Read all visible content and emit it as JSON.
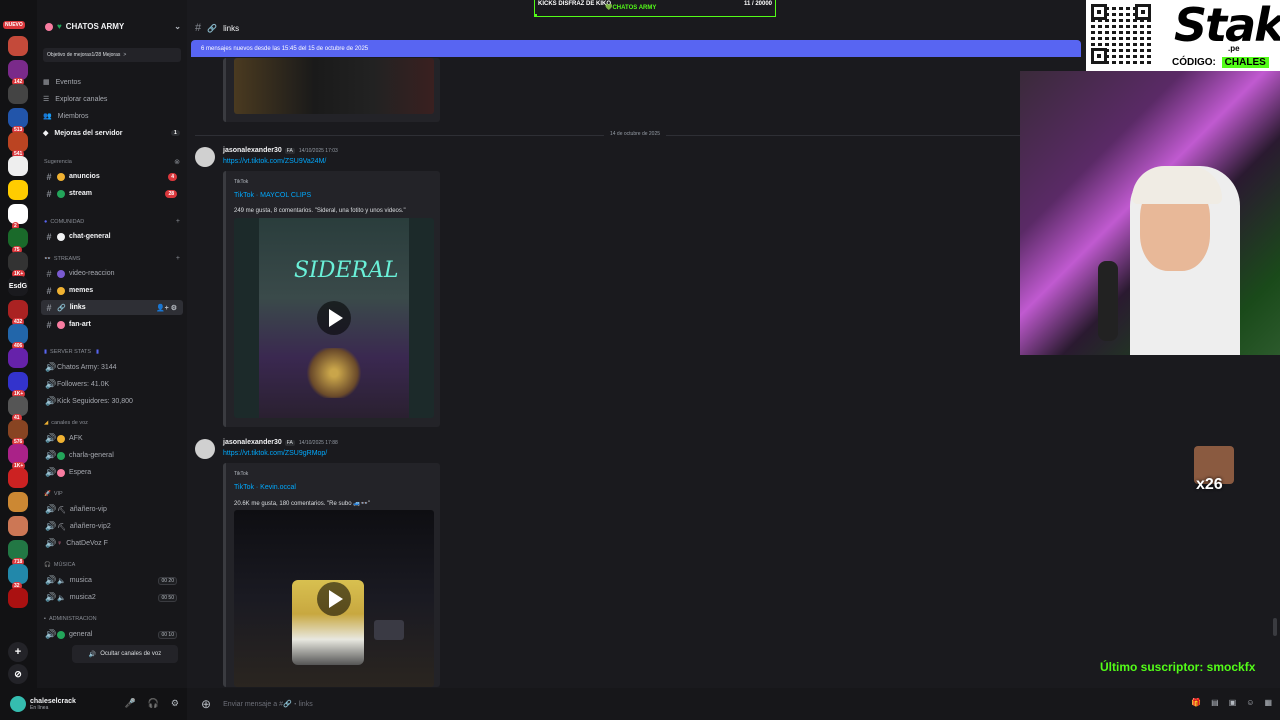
{
  "rail": {
    "new_label": "NUEVO",
    "servers": [
      {
        "badge": "",
        "color": "#c44a3a"
      },
      {
        "badge": "142",
        "color": "#7a2a8a"
      },
      {
        "badge": "",
        "color": "#444"
      },
      {
        "badge": "513",
        "color": "#2255aa"
      },
      {
        "badge": "541",
        "color": "#bb4422"
      },
      {
        "badge": "",
        "color": "#eeeeee"
      },
      {
        "badge": "",
        "color": "#ffcc00"
      },
      {
        "badge": "2",
        "color": "#ffffff"
      },
      {
        "badge": "75",
        "color": "#1a6a2a"
      },
      {
        "badge": "1K+",
        "color": "#333"
      },
      {
        "badge": "",
        "color": "#1a1a1e",
        "text": "EsdG"
      },
      {
        "badge": "432",
        "color": "#aa2222"
      },
      {
        "badge": "406",
        "color": "#2266aa"
      },
      {
        "badge": "",
        "color": "#6622aa"
      },
      {
        "badge": "1K+",
        "color": "#3333cc"
      },
      {
        "badge": "41",
        "color": "#555"
      },
      {
        "badge": "576",
        "color": "#884422"
      },
      {
        "badge": "1K+",
        "color": "#aa2288"
      },
      {
        "badge": "",
        "color": "#cc2222"
      },
      {
        "badge": "",
        "color": "#cc8833"
      },
      {
        "badge": "",
        "color": "#cc7755"
      },
      {
        "badge": "718",
        "color": "#227744"
      },
      {
        "badge": "32",
        "color": "#2288aa"
      },
      {
        "badge": "",
        "color": "#aa1111"
      }
    ]
  },
  "sidebar": {
    "server_name": "CHATOS ARMY",
    "goal_label": "Objetivo de mejoras",
    "goal_value": "1/28 Mejoras",
    "goal_chevron": ">",
    "nav": [
      {
        "label": "Eventos"
      },
      {
        "label": "Explorar canales"
      },
      {
        "label": "Miembros"
      },
      {
        "label": "Mejoras del servidor",
        "count": "1"
      }
    ],
    "sugerencia": "Sugerencia",
    "channels_top": [
      {
        "label": "anuncios",
        "badge": "4",
        "emo": "#f0b232"
      },
      {
        "label": "stream",
        "badge": "28",
        "emo": "#23a55a"
      }
    ],
    "cat_comunidad": "COMUNIDAD",
    "chat_general": "chat-general",
    "cat_streams": "STREAMS",
    "channels_streams": [
      {
        "label": "video-reaccion",
        "bold": false,
        "emo": "#7a5ad0"
      },
      {
        "label": "memes",
        "bold": true,
        "emo": "#f0b232"
      },
      {
        "label": "links",
        "bold": true,
        "active": true,
        "emo": "#b5bac1"
      },
      {
        "label": "fan-art",
        "bold": true,
        "emo": "#f87ca0"
      }
    ],
    "cat_stats": "SERVER STATS",
    "stats": [
      {
        "label": "Chatos Army: 3144"
      },
      {
        "label": "Followers: 41.0K"
      },
      {
        "label": "Kick Seguidores: 30,800"
      }
    ],
    "cat_voz": "canales de voz",
    "voice_a": [
      {
        "label": "AFK",
        "emo": "#f0b232"
      },
      {
        "label": "charla-general",
        "emo": "#23a55a"
      },
      {
        "label": "Espera",
        "emo": "#f87ca0"
      }
    ],
    "cat_vip": "VIP",
    "voice_vip": [
      {
        "label": "añañero-vip"
      },
      {
        "label": "añañero-vip2"
      },
      {
        "label": "ChatDeVoz F"
      }
    ],
    "cat_musica": "MÚSICA",
    "voice_musica": [
      {
        "label": "musica",
        "vc": "00 20"
      },
      {
        "label": "musica2",
        "vc": "00 50"
      }
    ],
    "cat_admin": "ADMINISTRACION",
    "voice_admin": [
      {
        "label": "general",
        "vc": "00 10"
      }
    ],
    "hide_voice": "Ocultar canales de voz"
  },
  "user": {
    "name": "chaleselcrack",
    "status": "En línea"
  },
  "main": {
    "channel_name": "links",
    "new_messages": "6 mensajes nuevos desde las 15:45 del 15 de octubre de 2025",
    "date_divider": "14 de octubre de 2025",
    "messages": [
      {
        "author": "jasonalexander30",
        "tag": "FA",
        "time": "14/10/2025 17:03",
        "link": "https://vt.tiktok.com/ZSU9Va24M/",
        "provider": "TikTok",
        "title": "TikTok · MAYCOL CLIPS",
        "desc": "249 me gusta, 8 comentarios. \"Sideral, una fotito y unos videos.\"",
        "video_text": "SIDERAL"
      },
      {
        "author": "jasonalexander30",
        "tag": "FA",
        "time": "14/10/2025 17:88",
        "link": "https://vt.tiktok.com/ZSU9gRMop/",
        "provider": "TikTok",
        "title": "TikTok · Kevin.occal",
        "desc": "20.6K me gusta, 180 comentarios. \"Re subo 🚙👓\""
      }
    ],
    "composer_placeholder": "Enviar mensaje a #🔗・links"
  },
  "overlay": {
    "goal_left": "KICKS DISFRAZ DE KIKO",
    "goal_center": "💚CHATOS ARMY",
    "goal_right": "11 / 20000",
    "goal_progress": 0.00055,
    "stake_logo": "Stake",
    "stake_domain": ".pe",
    "stake_code_label": "CÓDIGO:",
    "stake_code": "CHALES",
    "emote_count": "x26",
    "last_sub": "Último suscriptor: smockfx",
    "accent": "#53fc18"
  }
}
